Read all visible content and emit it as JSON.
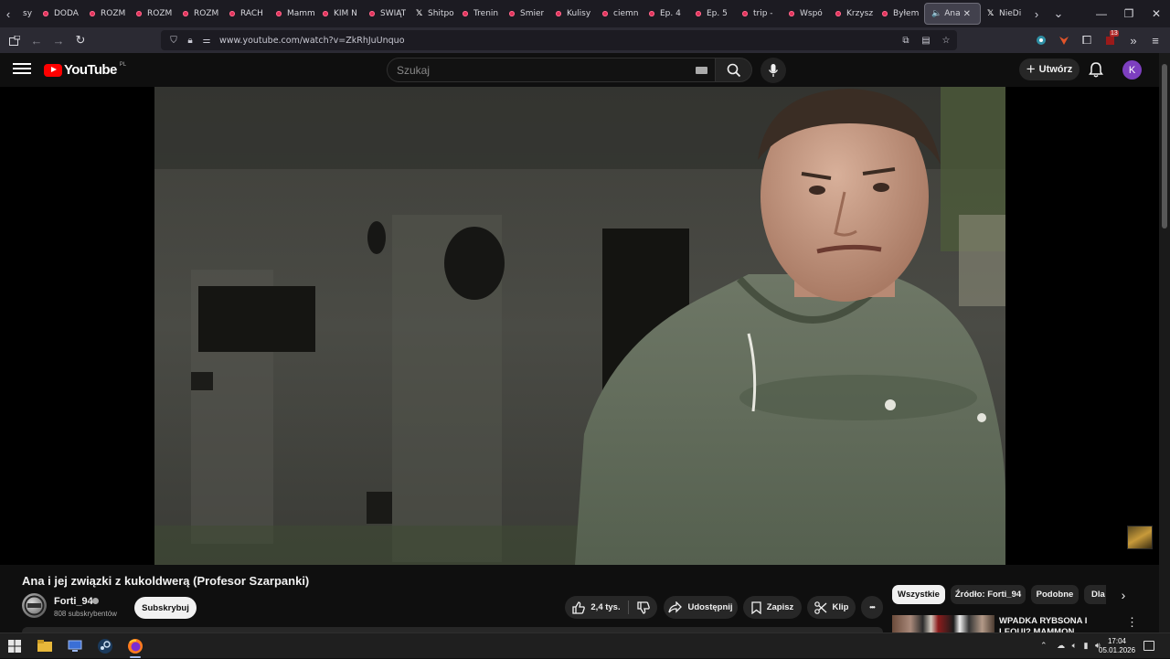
{
  "browser": {
    "tabs": [
      {
        "label": "sy",
        "icon": "none"
      },
      {
        "label": "DODA",
        "icon": "youtube-icon"
      },
      {
        "label": "ROZM",
        "icon": "youtube-icon"
      },
      {
        "label": "ROZM",
        "icon": "youtube-icon"
      },
      {
        "label": "ROZM",
        "icon": "youtube-icon"
      },
      {
        "label": "RACH",
        "icon": "youtube-icon"
      },
      {
        "label": "Mamm",
        "icon": "youtube-icon"
      },
      {
        "label": "KIM N",
        "icon": "youtube-icon"
      },
      {
        "label": "ŚWIĄT",
        "icon": "youtube-icon"
      },
      {
        "label": "Shitpo",
        "icon": "x-icon"
      },
      {
        "label": "Trenin",
        "icon": "youtube-icon"
      },
      {
        "label": "Śmier",
        "icon": "youtube-icon"
      },
      {
        "label": "Kulisy",
        "icon": "youtube-icon"
      },
      {
        "label": "ciemn",
        "icon": "youtube-icon"
      },
      {
        "label": "Ep. 4",
        "icon": "youtube-icon"
      },
      {
        "label": "Ep. 5",
        "icon": "youtube-icon"
      },
      {
        "label": "trip -",
        "icon": "youtube-icon"
      },
      {
        "label": "Wspó",
        "icon": "youtube-icon"
      },
      {
        "label": "Krzysz",
        "icon": "youtube-icon"
      },
      {
        "label": "Byłem",
        "icon": "youtube-icon"
      }
    ],
    "active_tab": {
      "label": "Ana"
    },
    "after_tab": {
      "label": "NieDi"
    },
    "url": "www.youtube.com/watch?v=ZkRhJuUnquo",
    "extension_badge": "13"
  },
  "youtube": {
    "logo_text": "YouTube",
    "logo_country": "PL",
    "search_placeholder": "Szukaj",
    "create_label": "Utwórz",
    "avatar_letter": "K",
    "video": {
      "title": "Ana i jej związki z kukoldwerą (Profesor Szarpanki)"
    },
    "channel": {
      "name": "Forti_94",
      "subscribers": "808 subskrybentów",
      "subscribe_label": "Subskrybuj"
    },
    "actions": {
      "likes": "2,4 tys.",
      "share": "Udostępnij",
      "save": "Zapisz",
      "clip": "Klip",
      "more": "•••"
    },
    "chips": [
      {
        "label": "Wszystkie",
        "selected": true
      },
      {
        "label": "Źródło: Forti_94",
        "selected": false
      },
      {
        "label": "Podobne",
        "selected": false
      },
      {
        "label": "Dla",
        "selected": false
      }
    ],
    "recommendation": {
      "title": "WPADKA RYBSONA I LEQUI? MAMMON KONFRONTUJE"
    }
  },
  "taskbar": {
    "time": "17:04",
    "date": "05.01.2026"
  },
  "colors": {
    "yt_red": "#ff0000",
    "tab_favicon": "#e1325a",
    "avatar_bg": "#7d3fbf"
  }
}
